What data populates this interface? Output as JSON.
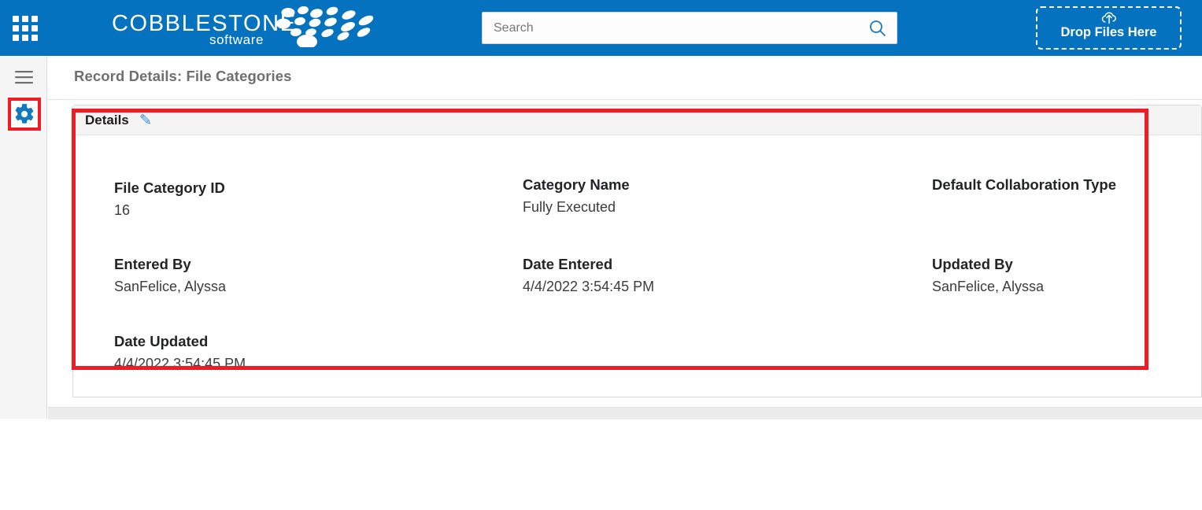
{
  "header": {
    "background_color": "#0572bf",
    "app_launcher_icon": "app-grid-icon",
    "brand_name": "COBBLESTONE",
    "brand_tagline": "software",
    "brand_mark_icon": "cobblestone-pebbles-logo",
    "search": {
      "placeholder": "Search",
      "value": "",
      "icon": "search-icon"
    },
    "dropzone": {
      "label": "Drop Files Here",
      "icon": "cloud-upload-icon"
    }
  },
  "sidebar": {
    "menu_toggle_icon": "hamburger-menu-icon",
    "items": [
      {
        "icon": "gear-icon",
        "label": "Settings",
        "selected": true
      }
    ]
  },
  "main": {
    "page_title": "Record Details: File Categories",
    "panel": {
      "title": "Details",
      "edit_icon": "pencil-edit-icon",
      "highlight_color": "#ee1c25",
      "fields": [
        {
          "label": "File Category ID",
          "value": "16",
          "column": 1,
          "row": 1
        },
        {
          "label": "Category Name",
          "value": "Fully Executed",
          "column": 2,
          "row": 1
        },
        {
          "label": "Default Collaboration Type",
          "value": "",
          "column": 3,
          "row": 1
        },
        {
          "label": "Entered By",
          "value": "SanFelice, Alyssa",
          "column": 1,
          "row": 2
        },
        {
          "label": "Date Entered",
          "value": "4/4/2022 3:54:45 PM",
          "column": 2,
          "row": 2
        },
        {
          "label": "Updated By",
          "value": "SanFelice, Alyssa",
          "column": 3,
          "row": 2
        },
        {
          "label": "Date Updated",
          "value": "4/4/2022 3:54:45 PM",
          "column": 1,
          "row": 3
        }
      ]
    }
  }
}
